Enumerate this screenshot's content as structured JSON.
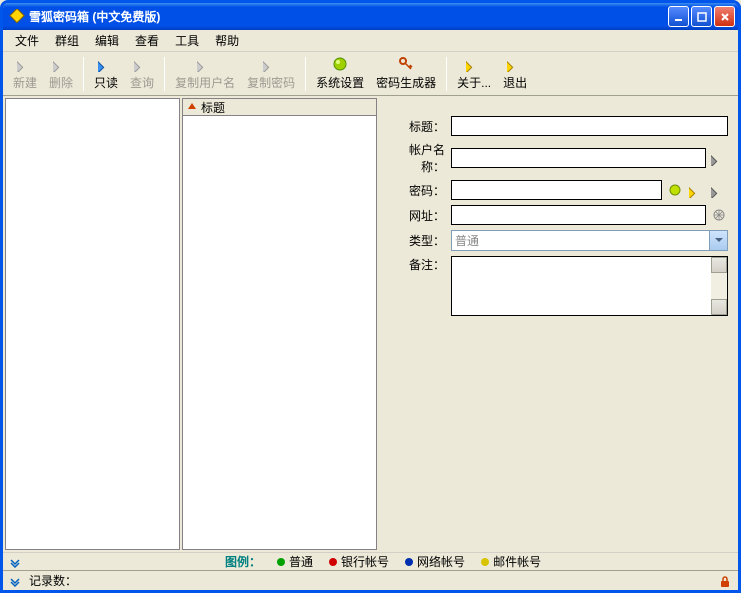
{
  "title": "雪狐密码箱 (中文免费版)",
  "menu": [
    "文件",
    "群组",
    "编辑",
    "查看",
    "工具",
    "帮助"
  ],
  "toolbar": {
    "new": "新建",
    "delete": "删除",
    "readonly": "只读",
    "query": "查询",
    "copyuser": "复制用户名",
    "copypwd": "复制密码",
    "settings": "系统设置",
    "pwdgen": "密码生成器",
    "about": "关于...",
    "exit": "退出"
  },
  "listHeader": "标题",
  "form": {
    "titleLabel": "标题：",
    "accountLabel": "帐户名称：",
    "passwordLabel": "密码：",
    "urlLabel": "网址：",
    "typeLabel": "类型：",
    "typeValue": "普通",
    "noteLabel": "备注："
  },
  "legend": {
    "label": "图例：",
    "items": [
      {
        "label": "普通",
        "color": "#00a000"
      },
      {
        "label": "银行帐号",
        "color": "#d00000"
      },
      {
        "label": "网络帐号",
        "color": "#0030b0"
      },
      {
        "label": "邮件帐号",
        "color": "#d8c400"
      }
    ]
  },
  "status": {
    "records": "记录数："
  },
  "colors": {
    "accent": "#0055ea"
  }
}
